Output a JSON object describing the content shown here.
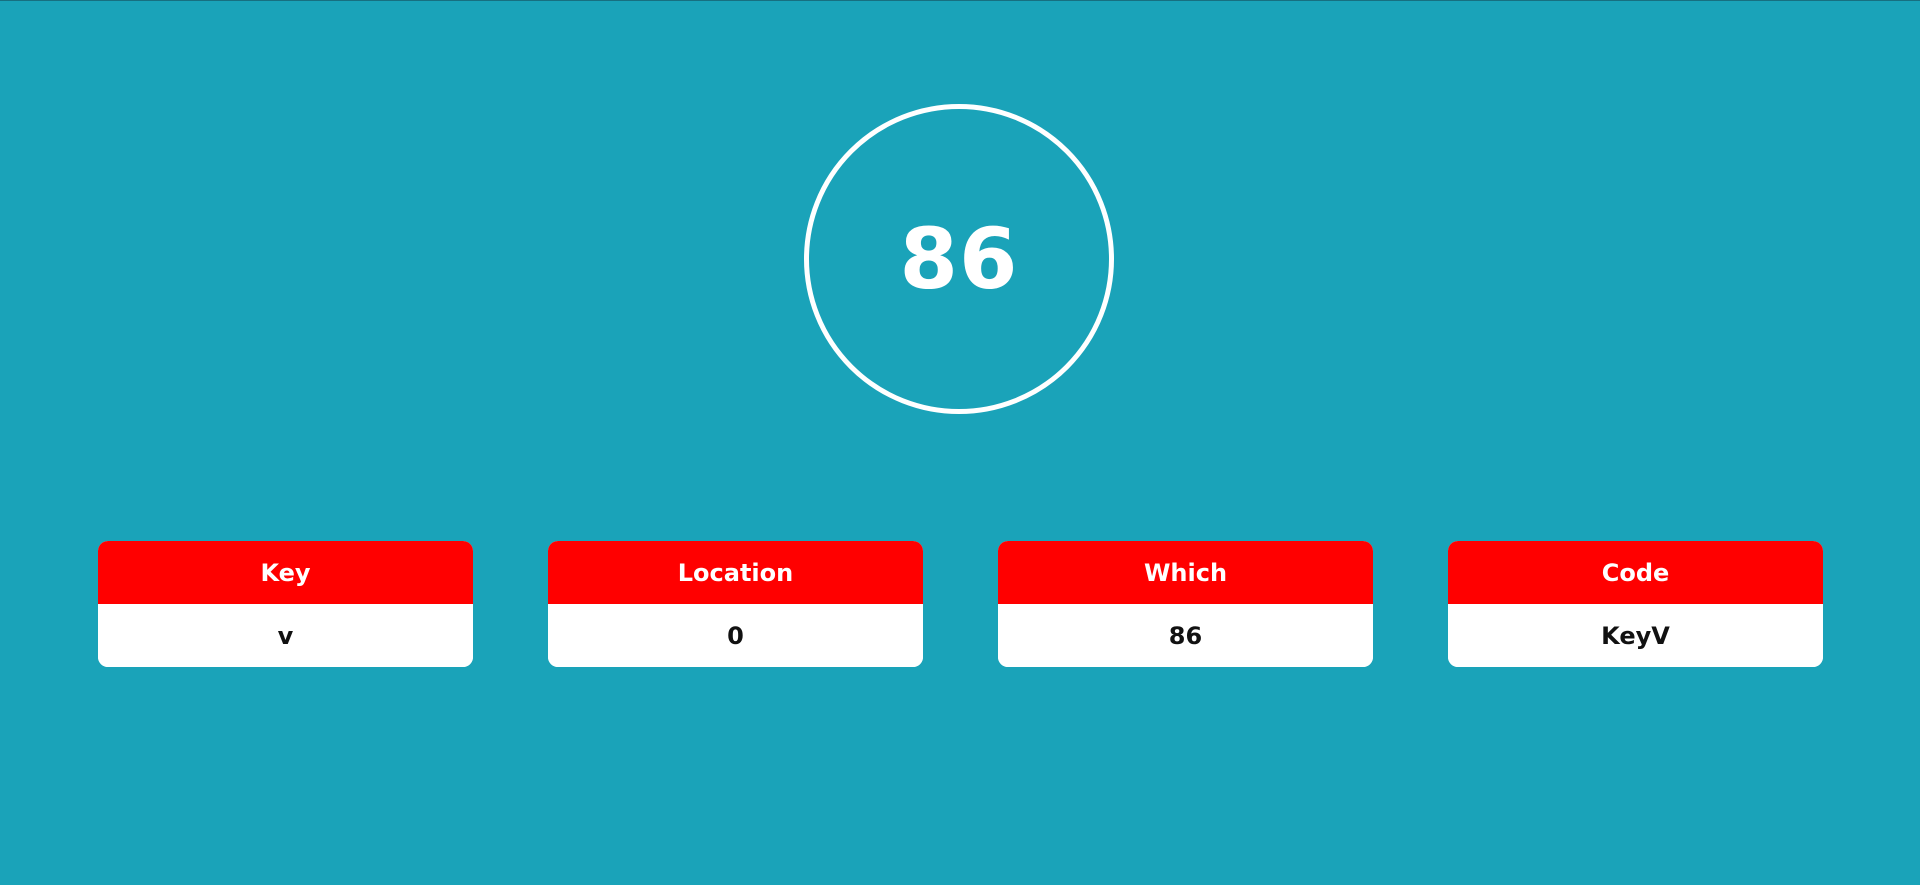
{
  "key_display": {
    "number": "86"
  },
  "cards": [
    {
      "label": "Key",
      "value": "v"
    },
    {
      "label": "Location",
      "value": "0"
    },
    {
      "label": "Which",
      "value": "86"
    },
    {
      "label": "Code",
      "value": "KeyV"
    }
  ],
  "colors": {
    "background": "#1aa3b9",
    "card_header": "#ff0000",
    "card_body": "#ffffff"
  }
}
